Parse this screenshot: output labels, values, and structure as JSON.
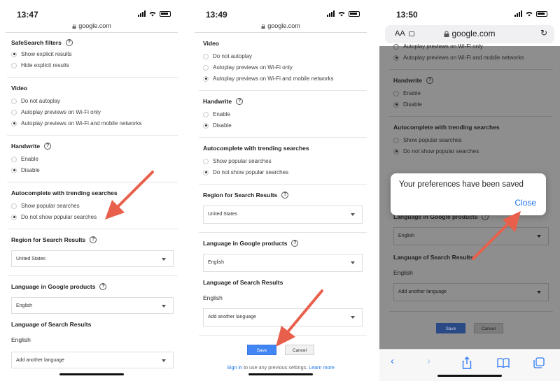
{
  "panels": [
    {
      "time": "13:47",
      "host": "google.com",
      "safesearch": {
        "title": "SafeSearch filters",
        "options": [
          "Show explicit results",
          "Hide explicit results"
        ]
      },
      "video": {
        "title": "Video",
        "options": [
          "Do not autoplay",
          "Autoplay previews on Wi-Fi only",
          "Autoplay previews on Wi-Fi and mobile networks"
        ]
      },
      "handwrite": {
        "title": "Handwrite",
        "options": [
          "Enable",
          "Disable"
        ]
      },
      "autocomplete": {
        "title": "Autocomplete with trending searches",
        "options": [
          "Show popular searches",
          "Do not show popular searches"
        ]
      },
      "region": {
        "title": "Region for Search Results",
        "value": "United States"
      },
      "language_google": {
        "title": "Language in Google products",
        "value": "English"
      },
      "language_results": {
        "title": "Language of Search Results",
        "english": "English",
        "add_label": "Add another language"
      }
    },
    {
      "time": "13:49",
      "host": "google.com",
      "video": {
        "title": "Video",
        "options": [
          "Do not autoplay",
          "Autoplay previews on Wi-Fi only",
          "Autoplay previews on Wi-Fi and mobile networks"
        ]
      },
      "handwrite": {
        "title": "Handwrite",
        "options": [
          "Enable",
          "Disable"
        ]
      },
      "autocomplete": {
        "title": "Autocomplete with trending searches",
        "options": [
          "Show popular searches",
          "Do not show popular searches"
        ]
      },
      "region": {
        "title": "Region for Search Results",
        "value": "United States"
      },
      "language_google": {
        "title": "Language in Google products",
        "value": "English"
      },
      "language_results": {
        "title": "Language of Search Results",
        "english": "English",
        "add_label": "Add another language"
      },
      "save_label": "Save",
      "cancel_label": "Cancel",
      "signin_link": "Sign in",
      "signin_text": "to use any previous settings.",
      "learn_more": "Learn more"
    },
    {
      "time": "13:50",
      "aa": "AA",
      "host": "google.com",
      "video_options": [
        "Autoplay previews on Wi-Fi only",
        "Autoplay previews on Wi-Fi and mobile networks"
      ],
      "handwrite": {
        "title": "Handwrite",
        "options": [
          "Enable",
          "Disable"
        ]
      },
      "autocomplete": {
        "title": "Autocomplete with trending searches",
        "options": [
          "Show popular searches",
          "Do not show popular searches"
        ]
      },
      "language_google": {
        "title": "Language in Google products",
        "value": "English"
      },
      "language_results": {
        "title": "Language of Search Results",
        "english": "English",
        "add_label": "Add another language"
      },
      "save_label": "Save",
      "cancel_label": "Cancel",
      "dialog": {
        "message": "Your preferences have been saved",
        "close": "Close"
      }
    }
  ],
  "colors": {
    "accent_blue": "#1a73e8",
    "save_blue": "#4285f4",
    "arrow_red": "#e8604c",
    "dim_overlay": "#8e8e8e"
  }
}
